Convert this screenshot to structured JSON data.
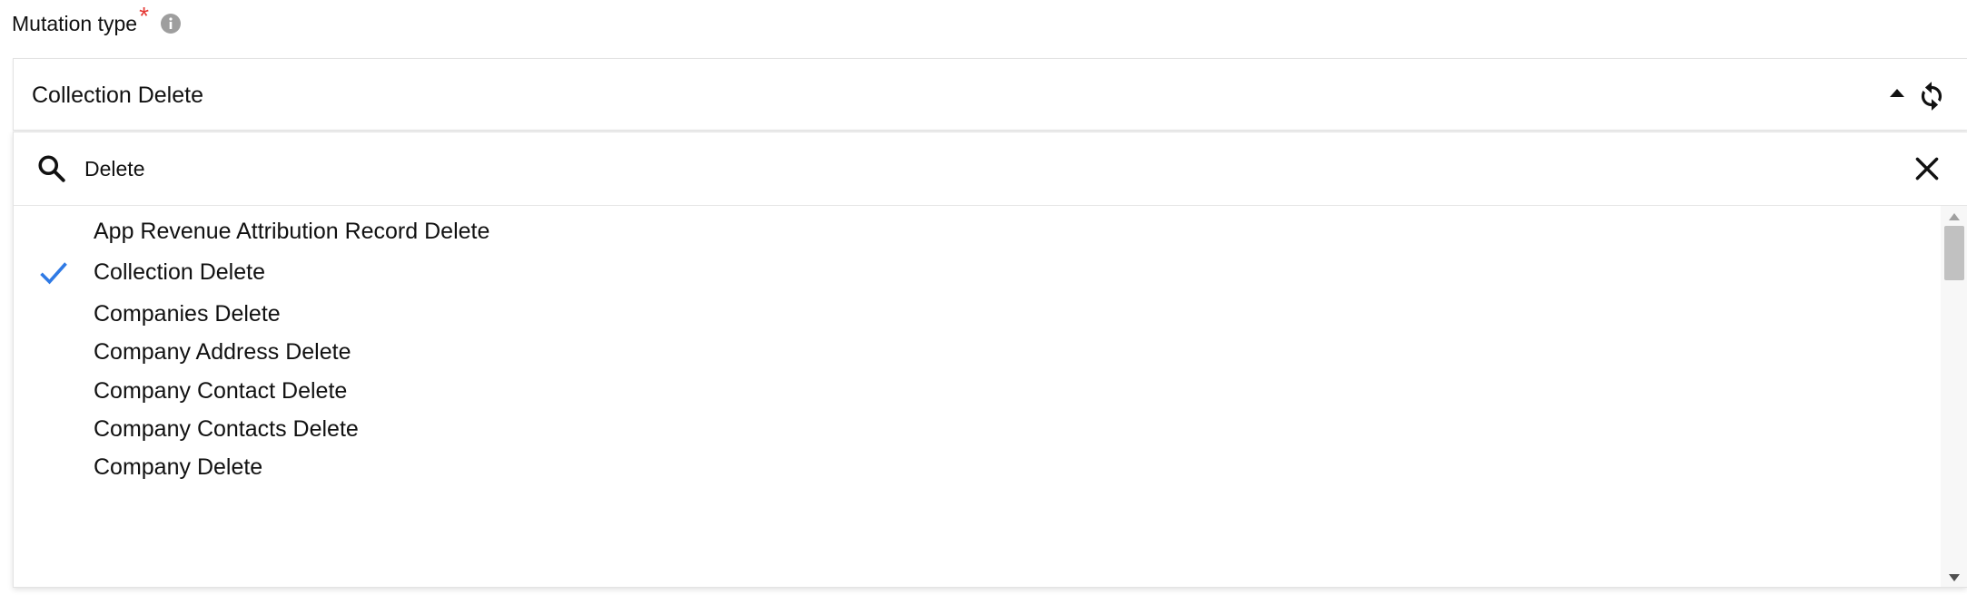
{
  "field": {
    "label": "Mutation type",
    "required_marker": "*"
  },
  "select": {
    "value": "Collection Delete"
  },
  "search": {
    "value": "Delete"
  },
  "options": [
    {
      "label": "App Revenue Attribution Record Delete",
      "selected": false
    },
    {
      "label": "Collection Delete",
      "selected": true
    },
    {
      "label": "Companies Delete",
      "selected": false
    },
    {
      "label": "Company Address Delete",
      "selected": false
    },
    {
      "label": "Company Contact Delete",
      "selected": false
    },
    {
      "label": "Company Contacts Delete",
      "selected": false
    },
    {
      "label": "Company Delete",
      "selected": false
    }
  ],
  "colors": {
    "required": "#e53935",
    "check": "#2f7ae5",
    "info_icon": "#9e9e9e"
  },
  "icons": {
    "info": "info-icon",
    "caret": "caret-up-icon",
    "refresh": "refresh-icon",
    "search": "search-icon",
    "clear": "close-icon",
    "check": "check-icon"
  }
}
